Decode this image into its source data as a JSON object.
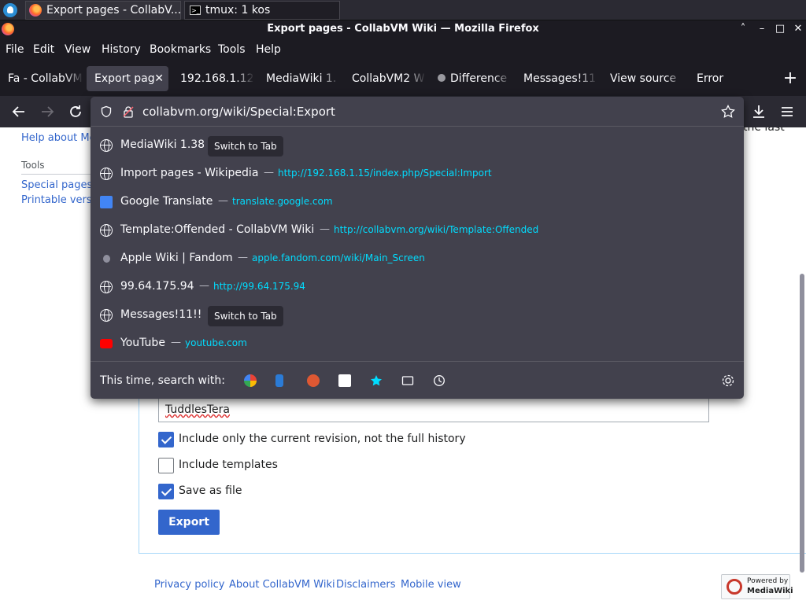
{
  "taskbar": {
    "tasks": [
      {
        "label": "Export pages - CollabV..."
      },
      {
        "label": "tmux: 1 kos"
      }
    ]
  },
  "window": {
    "title": "Export pages - CollabVM Wiki — Mozilla Firefox",
    "controls": [
      "˄",
      "–",
      "□",
      "✕"
    ]
  },
  "menubar": {
    "items": [
      {
        "label": "File"
      },
      {
        "label": "Edit"
      },
      {
        "label": "View"
      },
      {
        "label": "History"
      },
      {
        "label": "Bookmarks"
      },
      {
        "label": "Tools"
      },
      {
        "label": "Help"
      }
    ]
  },
  "tabs": [
    {
      "label": "Fa - CollabVM"
    },
    {
      "label": "Export pag",
      "close": "✕"
    },
    {
      "label": "192.168.1.12"
    },
    {
      "label": "MediaWiki 1."
    },
    {
      "label": "CollabVM2 W"
    },
    {
      "label": "Difference"
    },
    {
      "label": "Messages!11"
    },
    {
      "label": "View source"
    },
    {
      "label": "Error"
    }
  ],
  "new_tab": "+",
  "urlbar": {
    "value": "collabvm.org/wiki/Special:Export",
    "suggestions": [
      {
        "title": "MediaWiki 1.38",
        "badge": "Switch to Tab",
        "icon": "globe-icon"
      },
      {
        "title": "Import pages - Wikipedia",
        "sep": "—",
        "url": "http://192.168.1.15/index.php/Special:Import",
        "icon": "globe-icon"
      },
      {
        "title": "Google Translate",
        "sep": "—",
        "url": "translate.google.com",
        "icon": "google-translate-icon"
      },
      {
        "title": "Template:Offended - CollabVM Wiki",
        "sep": "—",
        "url": "http://collabvm.org/wiki/Template:Offended",
        "icon": "globe-icon"
      },
      {
        "title": "Apple Wiki | Fandom",
        "sep": "—",
        "url": "apple.fandom.com/wiki/Main_Screen",
        "icon": "apple-icon"
      },
      {
        "title": "99.64.175.94",
        "sep": "—",
        "url": "http://99.64.175.94",
        "icon": "globe-icon"
      },
      {
        "title": "Messages!11!!",
        "badge": "Switch to Tab",
        "icon": "globe-icon"
      },
      {
        "title": "YouTube",
        "sep": "—",
        "url": "youtube.com",
        "icon": "youtube-icon"
      }
    ],
    "search_label": "This time, search with:",
    "search_engines": [
      "google-icon",
      "bing-icon",
      "duckduckgo-icon",
      "ebay-icon",
      "bookmarks-icon",
      "tabs-icon",
      "history-icon"
    ]
  },
  "sidebar": {
    "help_link": "Help about Me",
    "tools_heading": "Tools",
    "tools": [
      {
        "label": "Special pages"
      },
      {
        "label": "Printable versi"
      }
    ]
  },
  "page": {
    "partial_text": "the last",
    "textarea_lines": [
      "TuddlesTera"
    ],
    "options": [
      {
        "label": "Include only the current revision, not the full history",
        "checked": true
      },
      {
        "label": "Include templates",
        "checked": false
      },
      {
        "label": "Save as file",
        "checked": true
      }
    ],
    "export_button": "Export"
  },
  "footer": {
    "links": [
      {
        "label": "Privacy policy"
      },
      {
        "label": "About CollabVM Wiki"
      },
      {
        "label": "Disclaimers"
      },
      {
        "label": "Mobile view"
      }
    ],
    "powered_line1": "Powered by",
    "powered_line2": "MediaWiki"
  }
}
